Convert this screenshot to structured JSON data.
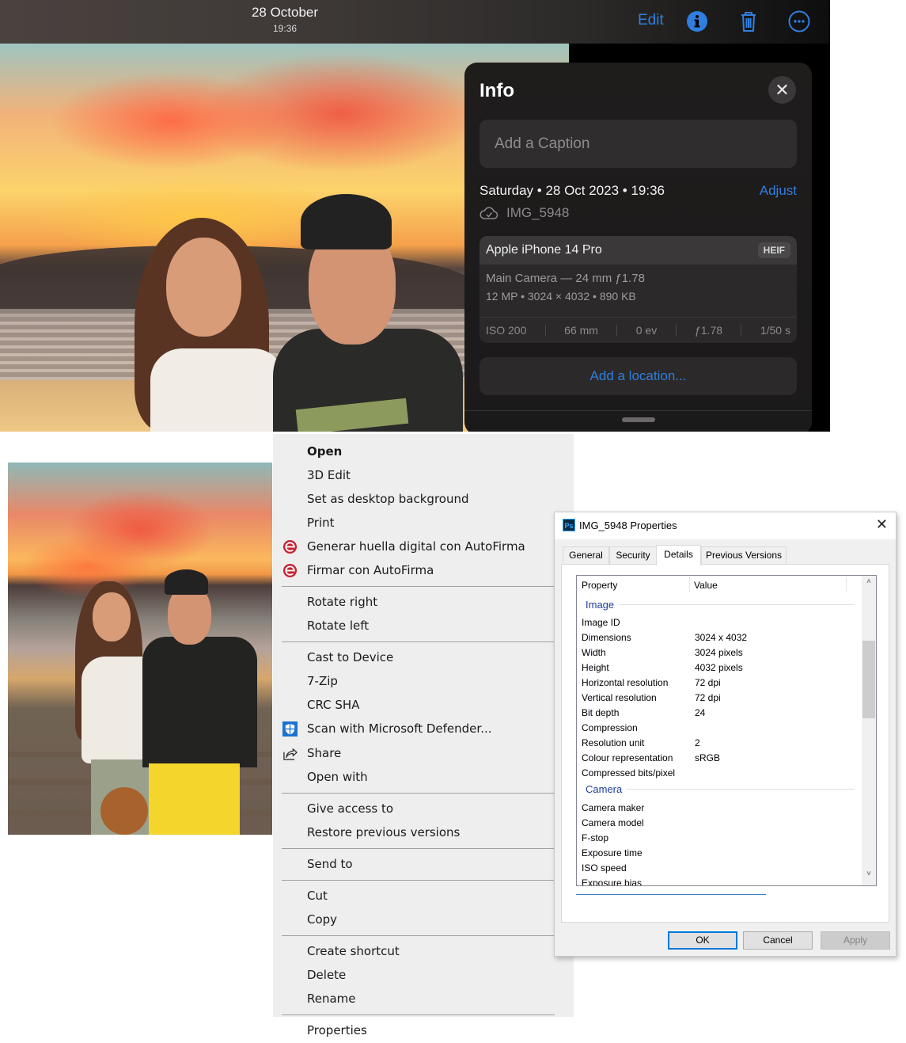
{
  "ios": {
    "topbar": {
      "date": "28 October",
      "time": "19:36",
      "edit_label": "Edit",
      "icons": [
        "info-icon",
        "trash-icon",
        "more-icon"
      ],
      "accent_color": "#2f7ee0"
    },
    "info_panel": {
      "title": "Info",
      "close_icon": "close-icon",
      "caption_placeholder": "Add a Caption",
      "date_line": "Saturday • 28 Oct 2023 • 19:36",
      "adjust_label": "Adjust",
      "filename": "IMG_5948",
      "cloud_icon": "icloud-check-icon",
      "camera": {
        "model": "Apple iPhone 14 Pro",
        "format_badge": "HEIF",
        "lens": "Main Camera — 24 mm ƒ1.78",
        "specs": "12 MP  •  3024 × 4032  •  890 KB",
        "exif": [
          "ISO 200",
          "66 mm",
          "0 ev",
          "ƒ1.78",
          "1/50 s"
        ]
      },
      "location_label": "Add a location..."
    }
  },
  "context_menu": {
    "items": [
      {
        "label": "Open",
        "bold": true
      },
      {
        "label": "3D Edit"
      },
      {
        "label": "Set as desktop background"
      },
      {
        "label": "Print"
      },
      {
        "label": "Generar huella digital con AutoFirma",
        "icon": "autofirma-icon"
      },
      {
        "label": "Firmar con AutoFirma",
        "icon": "autofirma-icon"
      },
      {
        "label": "Rotate right"
      },
      {
        "label": "Rotate left"
      },
      {
        "label": "Cast to Device"
      },
      {
        "label": "7-Zip"
      },
      {
        "label": "CRC SHA"
      },
      {
        "label": "Scan with Microsoft Defender...",
        "icon": "defender-shield-icon"
      },
      {
        "label": "Share",
        "icon": "share-icon"
      },
      {
        "label": "Open with"
      },
      {
        "label": "Give access to"
      },
      {
        "label": "Restore previous versions"
      },
      {
        "label": "Send to"
      },
      {
        "label": "Cut"
      },
      {
        "label": "Copy"
      },
      {
        "label": "Create shortcut"
      },
      {
        "label": "Delete"
      },
      {
        "label": "Rename"
      },
      {
        "label": "Properties",
        "highlighted": true
      }
    ]
  },
  "properties_dialog": {
    "title": "IMG_5948 Properties",
    "app_icon": "Ps",
    "tabs": [
      "General",
      "Security",
      "Details",
      "Previous Versions"
    ],
    "active_tab": "Details",
    "columns": [
      "Property",
      "Value"
    ],
    "groups": [
      {
        "name": "Image",
        "rows": [
          {
            "k": "Image ID",
            "v": ""
          },
          {
            "k": "Dimensions",
            "v": "3024 x 4032"
          },
          {
            "k": "Width",
            "v": "3024 pixels"
          },
          {
            "k": "Height",
            "v": "4032 pixels"
          },
          {
            "k": "Horizontal resolution",
            "v": "72 dpi"
          },
          {
            "k": "Vertical resolution",
            "v": "72 dpi"
          },
          {
            "k": "Bit depth",
            "v": "24"
          },
          {
            "k": "Compression",
            "v": ""
          },
          {
            "k": "Resolution unit",
            "v": "2"
          },
          {
            "k": "Colour representation",
            "v": "sRGB"
          },
          {
            "k": "Compressed bits/pixel",
            "v": ""
          }
        ]
      },
      {
        "name": "Camera",
        "rows": [
          {
            "k": "Camera maker",
            "v": ""
          },
          {
            "k": "Camera model",
            "v": ""
          },
          {
            "k": "F-stop",
            "v": ""
          },
          {
            "k": "Exposure time",
            "v": ""
          },
          {
            "k": "ISO speed",
            "v": ""
          },
          {
            "k": "Exposure bias",
            "v": ""
          }
        ]
      }
    ],
    "buttons": {
      "ok": "OK",
      "cancel": "Cancel",
      "apply": "Apply"
    }
  }
}
